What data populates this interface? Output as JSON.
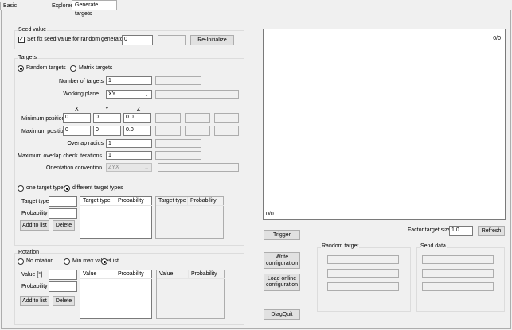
{
  "tabs": [
    "Basic configurations",
    "Explorer",
    "Generate targets"
  ],
  "seed": {
    "title": "Seed value",
    "checkbox_label": "Set fix seed value for random generator",
    "checked": true,
    "value": "0",
    "reinit_label": "Re-Initialize"
  },
  "targets": {
    "title": "Targets",
    "radio_random": "Random targets",
    "radio_matrix": "Matrix targets",
    "num_label": "Number of targets",
    "num_value": "1",
    "plane_label": "Working plane",
    "plane_value": "XY",
    "col_x": "X",
    "col_y": "Y",
    "col_z": "Z",
    "min_label": "Minimum position",
    "min_values": [
      "0",
      "0",
      "0.0"
    ],
    "max_label": "Maximum position",
    "max_values": [
      "0",
      "0",
      "0.0"
    ],
    "overlap_label": "Overlap radius",
    "overlap_value": "1",
    "maxiter_label": "Maximum overlap check iterations",
    "maxiter_value": "1",
    "orient_label": "Orientation convention",
    "orient_value": "ZYX",
    "radio_one": "one target type",
    "radio_diff": "different target types",
    "type_label": "Target type",
    "prob_label": "Probability",
    "add_label": "Add to list",
    "delete_label": "Delete",
    "list_col1": "Target type",
    "list_col2": "Probability"
  },
  "rotation": {
    "title": "Rotation",
    "radio_none": "No rotation",
    "radio_minmax": "Min max values",
    "radio_list": "List",
    "value_label": "Value [°]",
    "prob_label": "Probability",
    "add_label": "Add to list",
    "delete_label": "Delete",
    "list_col1": "Value",
    "list_col2": "Probability"
  },
  "canvas": {
    "top_right": "0/0",
    "bottom_left": "0/0"
  },
  "right": {
    "trigger_label": "Trigger",
    "factor_label": "Factor target size",
    "factor_value": "1.0",
    "refresh_label": "Refresh",
    "write_label": "Write configuration",
    "load_label": "Load online configuration",
    "diagquit_label": "DiagQuit",
    "random_title": "Random target",
    "send_title": "Send data"
  }
}
